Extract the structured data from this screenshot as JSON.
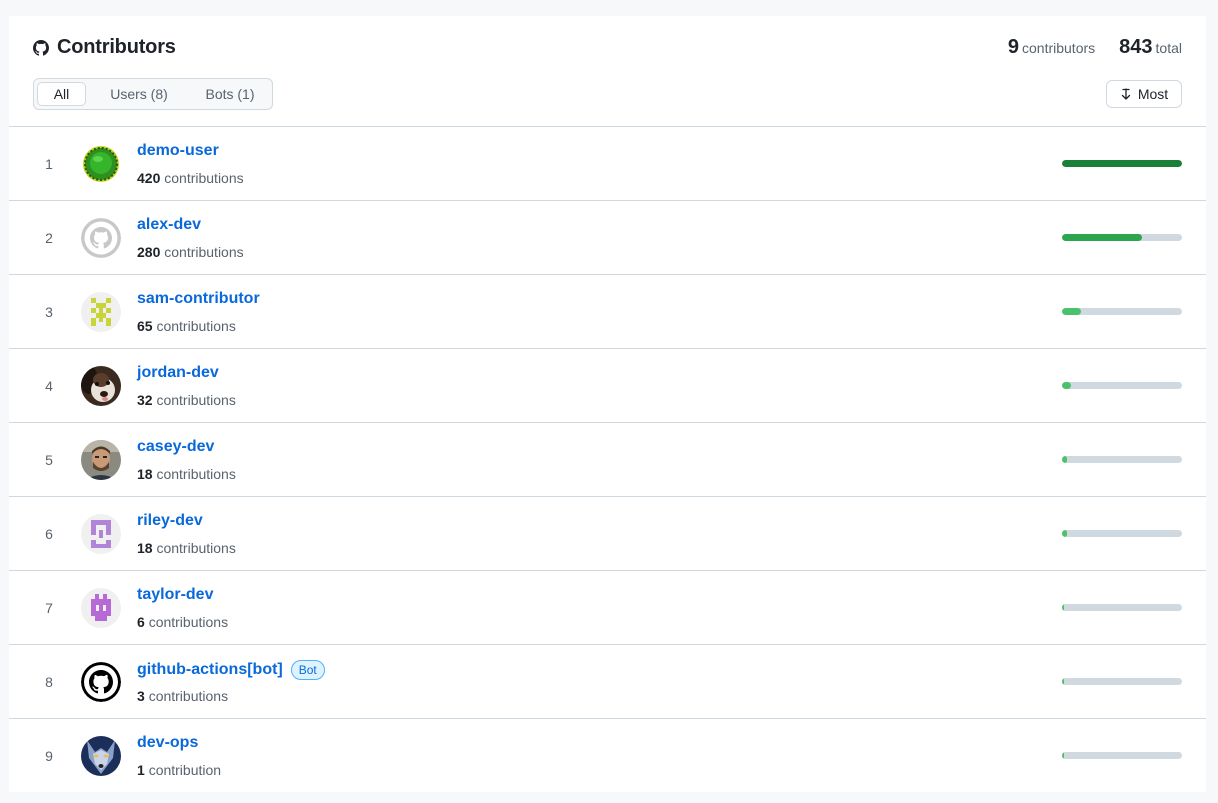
{
  "header": {
    "title": "Contributors",
    "contributors_count": "9",
    "contributors_label": "contributors",
    "total_count": "843",
    "total_label": "total"
  },
  "filters": [
    {
      "label": "All",
      "active": true
    },
    {
      "label": "Users (8)",
      "active": false
    },
    {
      "label": "Bots (1)",
      "active": false
    }
  ],
  "sort": {
    "label": "Most",
    "icon": "sort-desc-icon"
  },
  "colors": {
    "link": "#0969da",
    "bar_track": "#d1d9e0",
    "bar_dark": "#1a7f37",
    "bar_mid": "#2da44e",
    "bar_light": "#4ac26b"
  },
  "contributors": [
    {
      "rank": "1",
      "name": "demo-user",
      "count": "420",
      "unit": "contributions",
      "share": 1.0,
      "color": "#1a7f37",
      "avatar": "green-badge-avatar",
      "bot": false
    },
    {
      "rank": "2",
      "name": "alex-dev",
      "count": "280",
      "unit": "contributions",
      "share": 0.667,
      "color": "#2da44e",
      "avatar": "octocat-gray-avatar",
      "bot": false
    },
    {
      "rank": "3",
      "name": "sam-contributor",
      "count": "65",
      "unit": "contributions",
      "share": 0.155,
      "color": "#4ac26b",
      "avatar": "identicon-yellow-avatar",
      "bot": false
    },
    {
      "rank": "4",
      "name": "jordan-dev",
      "count": "32",
      "unit": "contributions",
      "share": 0.076,
      "color": "#4ac26b",
      "avatar": "dog-photo-avatar",
      "bot": false
    },
    {
      "rank": "5",
      "name": "casey-dev",
      "count": "18",
      "unit": "contributions",
      "share": 0.043,
      "color": "#4ac26b",
      "avatar": "person-photo-avatar",
      "bot": false
    },
    {
      "rank": "6",
      "name": "riley-dev",
      "count": "18",
      "unit": "contributions",
      "share": 0.043,
      "color": "#4ac26b",
      "avatar": "identicon-purple-avatar",
      "bot": false
    },
    {
      "rank": "7",
      "name": "taylor-dev",
      "count": "6",
      "unit": "contributions",
      "share": 0.014,
      "color": "#4ac26b",
      "avatar": "identicon-violet-avatar",
      "bot": false
    },
    {
      "rank": "8",
      "name": "github-actions[bot]",
      "count": "3",
      "unit": "contributions",
      "share": 0.007,
      "color": "#4ac26b",
      "avatar": "github-actions-avatar",
      "bot": true,
      "badge": "Bot"
    },
    {
      "rank": "9",
      "name": "dev-ops",
      "count": "1",
      "unit": "contribution",
      "share": 0.002,
      "color": "#4ac26b",
      "avatar": "wolf-photo-avatar",
      "bot": false
    }
  ]
}
